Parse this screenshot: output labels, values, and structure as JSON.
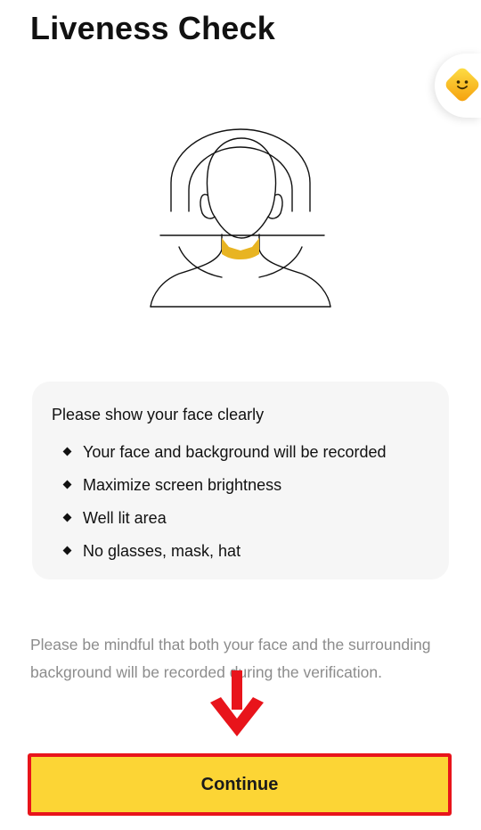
{
  "header": {
    "title": "Liveness Check"
  },
  "floating_widget": {
    "icon": "smiley-diamond-icon",
    "color": "#f9b61c"
  },
  "illustration": {
    "icon": "face-scan-illustration",
    "accent_color": "#e8b422"
  },
  "instructions": {
    "heading": "Please show your face clearly",
    "items": [
      "Your face and background will be recorded",
      "Maximize screen brightness",
      "Well lit area",
      "No glasses, mask, hat"
    ]
  },
  "disclaimer": "Please be mindful that both your face and the surrounding background will be recorded during the verification.",
  "continue_button": {
    "label": "Continue",
    "color": "#fcd535",
    "highlight_border": "#e8141b"
  },
  "annotation": {
    "arrow_color": "#e8141b",
    "arrow_direction": "down"
  }
}
